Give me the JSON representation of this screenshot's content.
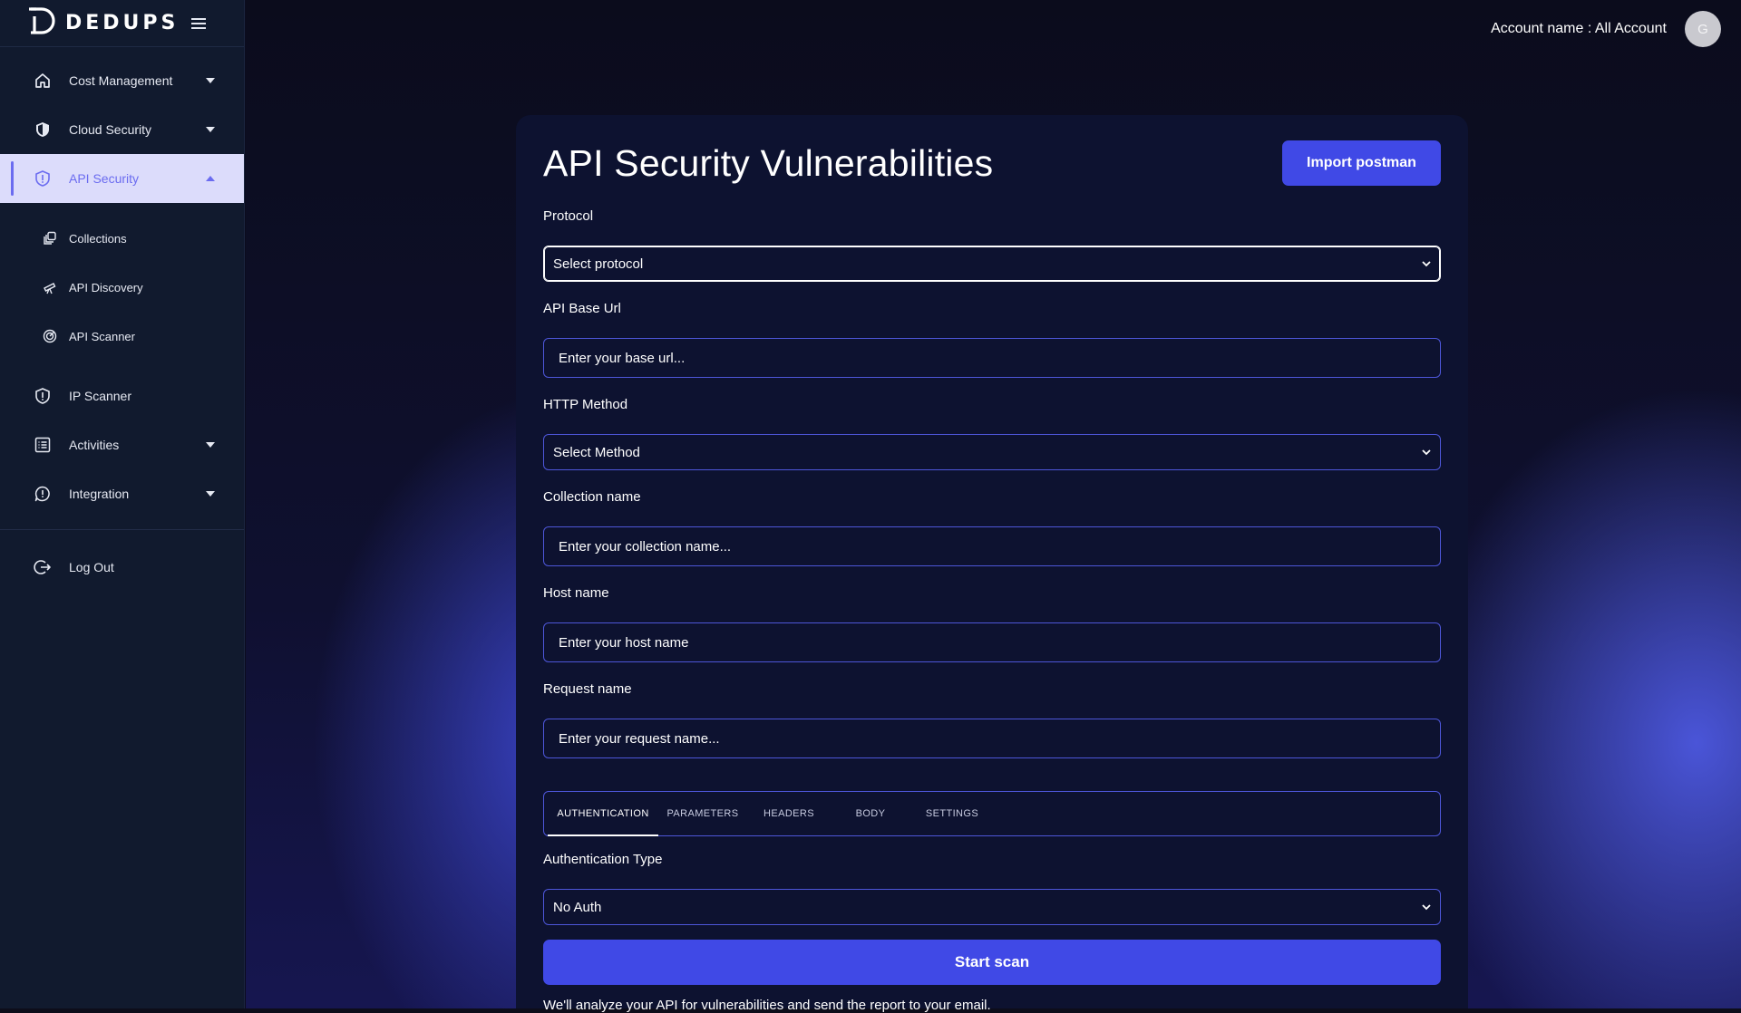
{
  "brand": {
    "name": "DEDUPS",
    "logo_icon": "dedups-logo-icon",
    "menu_icon": "hamburger-menu-icon"
  },
  "sidebar": {
    "items": [
      {
        "label": "Cost Management",
        "icon": "home-icon",
        "expandable": true,
        "expanded": false
      },
      {
        "label": "Cloud Security",
        "icon": "shield-icon",
        "expandable": true,
        "expanded": false
      },
      {
        "label": "API Security",
        "icon": "shield-alert-icon",
        "expandable": true,
        "expanded": true,
        "active": true,
        "children": [
          {
            "label": "Collections",
            "icon": "collections-icon"
          },
          {
            "label": "API Discovery",
            "icon": "telescope-icon"
          },
          {
            "label": "API Scanner",
            "icon": "radar-icon"
          }
        ]
      },
      {
        "label": "IP Scanner",
        "icon": "shield-exclamation-icon",
        "expandable": false
      },
      {
        "label": "Activities",
        "icon": "list-icon",
        "expandable": true,
        "expanded": false
      },
      {
        "label": "Integration",
        "icon": "chat-alert-icon",
        "expandable": true,
        "expanded": false
      }
    ],
    "logout": {
      "label": "Log Out",
      "icon": "logout-icon"
    }
  },
  "topbar": {
    "account_text": "Account name : All Account",
    "avatar_initial": "G"
  },
  "page": {
    "title": "API Security Vulnerabilities",
    "import_button": "Import postman",
    "fields": {
      "protocol": {
        "label": "Protocol",
        "value": "Select protocol"
      },
      "base_url": {
        "label": "API Base Url",
        "placeholder": "Enter your base url..."
      },
      "http_method": {
        "label": "HTTP Method",
        "value": "Select Method"
      },
      "collection_name": {
        "label": "Collection name",
        "placeholder": "Enter your collection name..."
      },
      "host_name": {
        "label": "Host name",
        "placeholder": "Enter your host name"
      },
      "request_name": {
        "label": "Request name",
        "placeholder": "Enter your request name..."
      }
    },
    "tabs": [
      {
        "label": "AUTHENTICATION",
        "active": true
      },
      {
        "label": "PARAMETERS",
        "active": false
      },
      {
        "label": "HEADERS",
        "active": false
      },
      {
        "label": "BODY",
        "active": false
      },
      {
        "label": "SETTINGS",
        "active": false
      }
    ],
    "auth_type": {
      "label": "Authentication Type",
      "value": "No Auth"
    },
    "scan_button": "Start scan",
    "footnote": "We'll analyze your API for vulnerabilities and send the report to your email."
  },
  "colors": {
    "accent": "#4049e6",
    "sidebar_bg": "#111a2e",
    "active_item_bg": "#dcdcfb",
    "active_item_text": "#6b6cf0",
    "card_bg": "#0d1230",
    "input_border": "#4d56d8"
  }
}
